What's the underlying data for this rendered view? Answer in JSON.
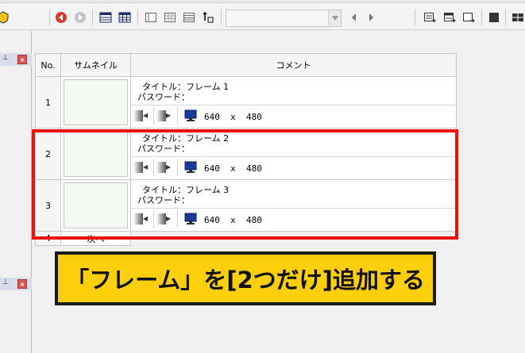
{
  "table": {
    "headers": {
      "no": "No.",
      "thumbnail": "サムネイル",
      "comment": "コメント"
    },
    "rows": [
      {
        "no": "1",
        "title_line": "タイトル：フレーム 1",
        "password_line": "パスワード：",
        "width": "640",
        "x": "x",
        "height": "480"
      },
      {
        "no": "2",
        "title_line": "タイトル：フレーム 2",
        "password_line": "パスワード：",
        "width": "640",
        "x": "x",
        "height": "480"
      },
      {
        "no": "3",
        "title_line": "タイトル：フレーム 3",
        "password_line": "パスワード：",
        "width": "640",
        "x": "x",
        "height": "480"
      }
    ],
    "next_row": {
      "no": "4",
      "label": "次へ"
    }
  },
  "banner": {
    "text": "「フレーム」を[2つだけ]追加する"
  },
  "colors": {
    "highlight": "#e8140c",
    "banner_bg": "#fccf0a",
    "banner_border": "#1a1a1a"
  },
  "icons": {
    "toolbar": [
      "back-red-icon",
      "forward-gray-icon",
      "list-view-icon",
      "grid-view-icon",
      "single-frame-icon",
      "multi-frame-icon",
      "lines-icon",
      "sort-icon",
      "prev-icon",
      "next-icon",
      "export-icon",
      "import-icon",
      "output-icon",
      "stop-icon",
      "cut-icon"
    ],
    "row": [
      "slide-in-icon",
      "slide-out-icon",
      "monitor-icon"
    ]
  }
}
